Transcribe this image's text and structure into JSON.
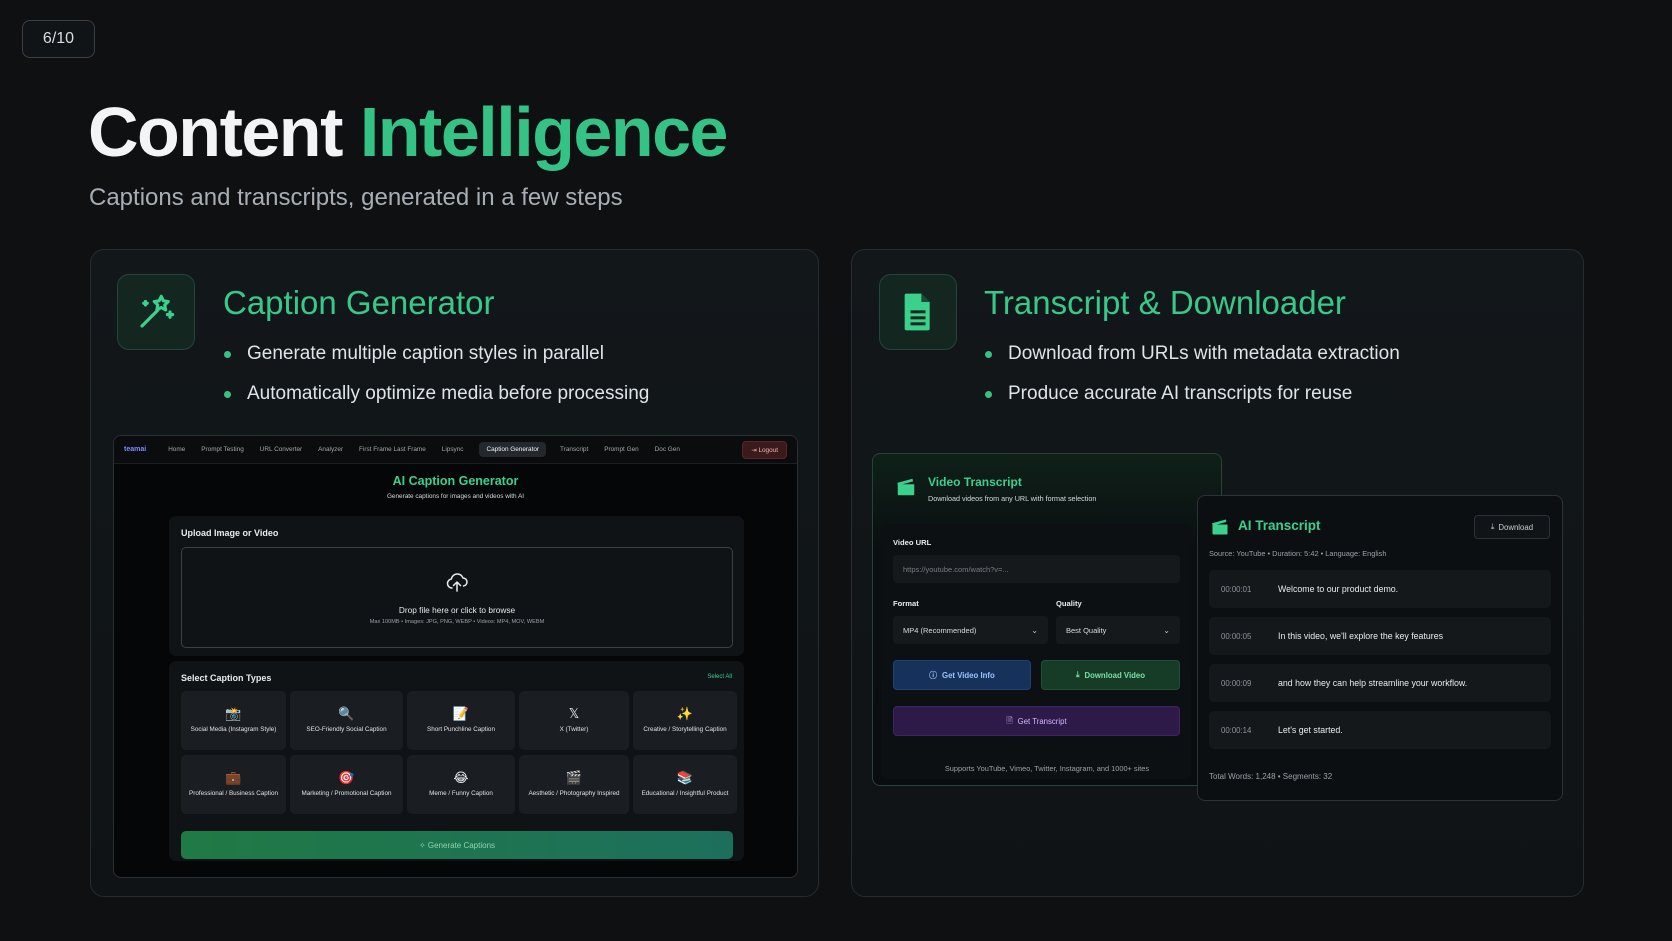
{
  "slide": {
    "counter": "6/10",
    "title_plain": "Content",
    "title_accent": "Intelligence",
    "subtitle": "Captions and transcripts, generated in a few steps"
  },
  "colors": {
    "accent": "#34c384",
    "background": "#0e1012"
  },
  "caption_card": {
    "icon": "magic-wand-sparkles-icon",
    "title": "Caption Generator",
    "bullets": [
      "Generate multiple caption styles in parallel",
      "Automatically optimize media before processing"
    ],
    "app": {
      "brand": "teamai",
      "nav": [
        "Home",
        "Prompt Testing",
        "URL Converter",
        "Analyzer",
        "First Frame Last Frame",
        "Lipsync",
        "Caption Generator",
        "Transcript",
        "Prompt Gen",
        "Doc Gen"
      ],
      "active_nav": "Caption Generator",
      "logout": "Logout",
      "title": "AI Caption Generator",
      "subtitle": "Generate captions for images and videos with AI",
      "upload_label": "Upload Image or Video",
      "drop_text": "Drop file here or click to browse",
      "drop_hint": "Max 100MB • Images: JPG, PNG, WEBP • Videos: MP4, MOV, WEBM",
      "types_label": "Select Caption Types",
      "select_all": "Select All",
      "caption_types": [
        {
          "icon": "📸",
          "label": "Social Media (Instagram Style)"
        },
        {
          "icon": "🔍",
          "label": "SEO-Friendly Social Caption"
        },
        {
          "icon": "📝",
          "label": "Short Punchline Caption"
        },
        {
          "icon": "𝕏",
          "label": "X (Twitter)"
        },
        {
          "icon": "✨",
          "label": "Creative / Storytelling Caption"
        },
        {
          "icon": "💼",
          "label": "Professional / Business Caption"
        },
        {
          "icon": "🎯",
          "label": "Marketing / Promotional Caption"
        },
        {
          "icon": "😂",
          "label": "Meme / Funny Caption"
        },
        {
          "icon": "🎬",
          "label": "Aesthetic / Photography Inspired"
        },
        {
          "icon": "📚",
          "label": "Educational / Insightful Product"
        }
      ],
      "generate_button": "✧ Generate Captions"
    }
  },
  "transcript_card": {
    "icon": "document-icon",
    "title": "Transcript & Downloader",
    "bullets": [
      "Download from URLs with metadata extraction",
      "Produce accurate AI transcripts for reuse"
    ],
    "video_panel": {
      "title": "Video Transcript",
      "subtitle": "Download videos from any URL with format selection",
      "url_label": "Video URL",
      "url_placeholder": "https://youtube.com/watch?v=...",
      "format_label": "Format",
      "format_value": "MP4 (Recommended)",
      "quality_label": "Quality",
      "quality_value": "Best Quality",
      "info_button": "Get Video Info",
      "download_button": "Download Video",
      "transcript_button": "Get Transcript",
      "supports": "Supports YouTube, Vimeo, Twitter, Instagram, and 1000+ sites"
    },
    "ai_panel": {
      "title": "AI Transcript",
      "download": "Download",
      "meta": "Source: YouTube • Duration: 5:42 • Language: English",
      "segments": [
        {
          "time": "00:00:01",
          "text": "Welcome to our product demo."
        },
        {
          "time": "00:00:05",
          "text": "In this video, we'll explore the key features"
        },
        {
          "time": "00:00:09",
          "text": "and how they can help streamline your workflow."
        },
        {
          "time": "00:00:14",
          "text": "Let's get started."
        }
      ],
      "footer": "Total Words: 1,248  •  Segments: 32"
    }
  }
}
